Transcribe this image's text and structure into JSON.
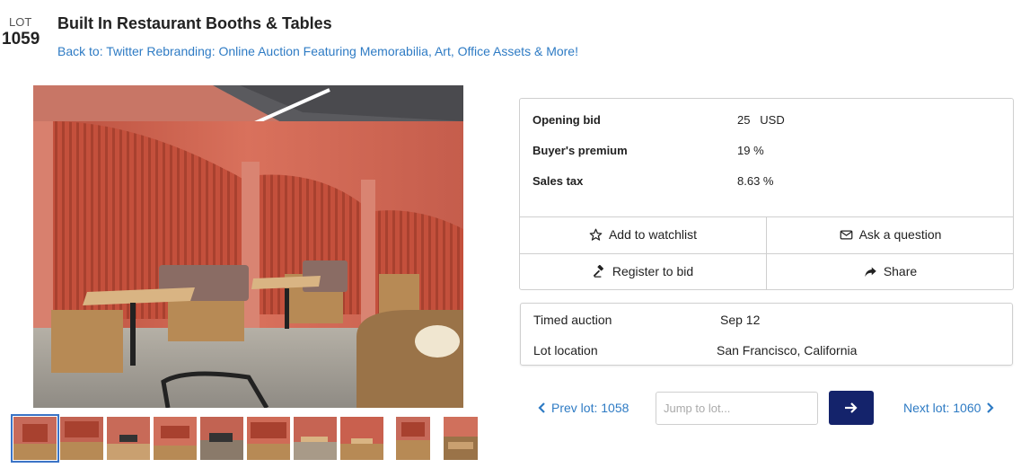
{
  "lot": {
    "label": "LOT",
    "number": "1059",
    "title": "Built In Restaurant Booths & Tables",
    "back_link": "Back to: Twitter Rebranding: Online Auction Featuring Memorabilia, Art, Office Assets & More!"
  },
  "bid_info": {
    "rows": [
      {
        "label": "Opening bid",
        "value": "25   USD"
      },
      {
        "label": "Buyer's premium",
        "value": "19 %"
      },
      {
        "label": "Sales tax",
        "value": "8.63 %"
      }
    ]
  },
  "actions": {
    "watchlist": "Add to watchlist",
    "ask": "Ask a question",
    "register": "Register to bid",
    "share": "Share"
  },
  "auction_info": {
    "rows": [
      {
        "label": "Timed auction",
        "value": "Sep 12"
      },
      {
        "label": "Lot location",
        "value": "San Francisco, California"
      }
    ]
  },
  "pagination": {
    "prev": "Prev lot: 1058",
    "next": "Next lot: 1060",
    "jump_placeholder": "Jump to lot..."
  },
  "thumbnails_count": 10,
  "colors": {
    "link": "#2e7bc4",
    "go_button": "#14236b",
    "border": "#cfcfcf",
    "selected_thumb": "#3b74c6"
  },
  "icons": {
    "watchlist": "star-icon",
    "ask": "envelope-icon",
    "register": "gavel-icon",
    "share": "share-arrow-icon",
    "go": "arrow-right-icon",
    "prev": "chevron-left-icon",
    "next": "chevron-right-icon"
  }
}
